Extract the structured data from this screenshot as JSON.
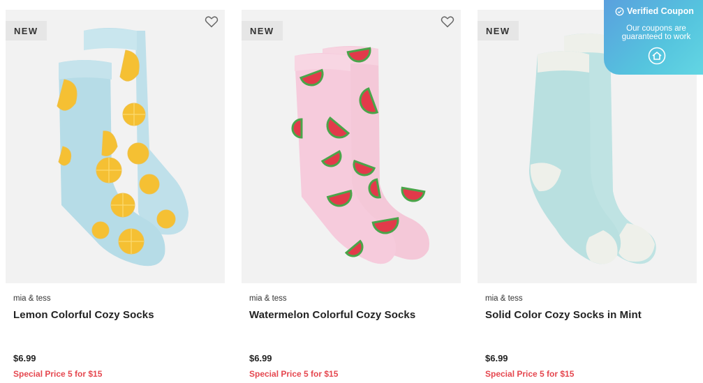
{
  "products": [
    {
      "badge": "NEW",
      "brand": "mia & tess",
      "title": "Lemon Colorful Cozy Socks",
      "price": "$6.99",
      "promo": "Special Price 5 for $15"
    },
    {
      "badge": "NEW",
      "brand": "mia & tess",
      "title": "Watermelon Colorful Cozy Socks",
      "price": "$6.99",
      "promo": "Special Price 5 for $15"
    },
    {
      "badge": "NEW",
      "brand": "mia & tess",
      "title": "Solid Color Cozy Socks in Mint",
      "price": "$6.99",
      "promo": "Special Price 5 for $15"
    }
  ],
  "coupon": {
    "heading": "Verified Coupon",
    "line1": "Our coupons are",
    "line2": "guaranteed to work",
    "icon": "home-icon"
  },
  "colors": {
    "promo": "#e5474f",
    "badge_bg": "#e6e6e6",
    "coupon_start": "#5aa0de",
    "coupon_end": "#63d6e3"
  }
}
